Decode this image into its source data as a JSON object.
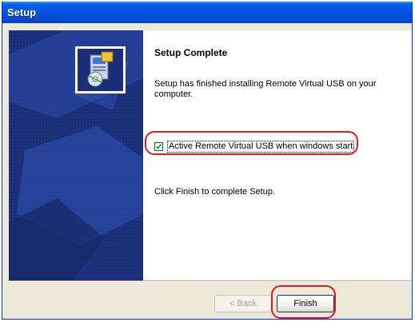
{
  "window": {
    "title": "Setup"
  },
  "wizard": {
    "heading": "Setup Complete",
    "message": "Setup has finished installing Remote Virtual USB on your computer.",
    "checkbox": {
      "label": "Active Remote Virtual USB when windows start",
      "checked": true
    },
    "instruction": "Click Finish to complete Setup."
  },
  "buttons": {
    "back_label": "< Back",
    "finish_label": "Finish"
  },
  "icons": {
    "setup": "setup-installer-icon",
    "check": "checkmark-icon"
  },
  "colors": {
    "titlebar": "#0054e3",
    "left_panel": "#1b2f78",
    "highlight_ring": "#d81e1e"
  }
}
